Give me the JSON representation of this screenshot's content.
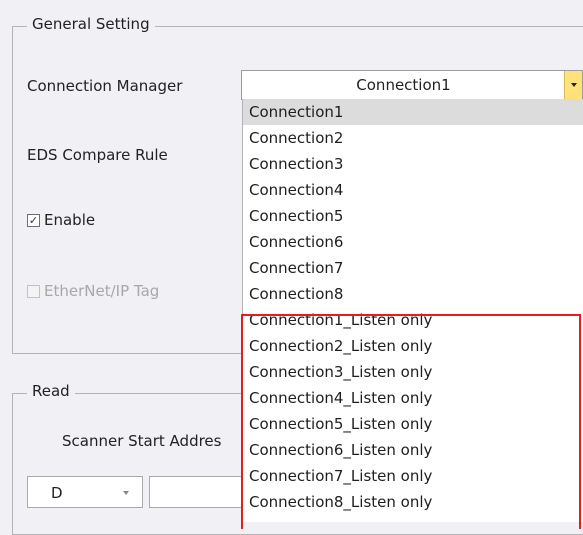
{
  "general": {
    "title": "General Setting",
    "connection_manager_label": "Connection Manager",
    "connection_manager_value": "Connection1",
    "eds_compare_label": "EDS Compare Rule",
    "enable_label": "Enable",
    "enable_checked": true,
    "enable_check_glyph": "✓",
    "ethernet_ip_tag_label": "EtherNet/IP Tag",
    "ethernet_ip_tag_checked": false
  },
  "read": {
    "title": "Read",
    "scanner_start_label": "Scanner Start Addres",
    "device_select_value": "D",
    "address_value": ""
  },
  "dropdown": {
    "selected_index": 0,
    "items": [
      "Connection1",
      "Connection2",
      "Connection3",
      "Connection4",
      "Connection5",
      "Connection6",
      "Connection7",
      "Connection8",
      "Connection1_Listen only",
      "Connection2_Listen only",
      "Connection3_Listen only",
      "Connection4_Listen only",
      "Connection5_Listen only",
      "Connection6_Listen only",
      "Connection7_Listen only",
      "Connection8_Listen only"
    ]
  },
  "colors": {
    "accent_dropdown_arrow": "#ffe27a",
    "highlight_box": "#e41e1e",
    "selected_item_bg": "#dcdcdc"
  }
}
